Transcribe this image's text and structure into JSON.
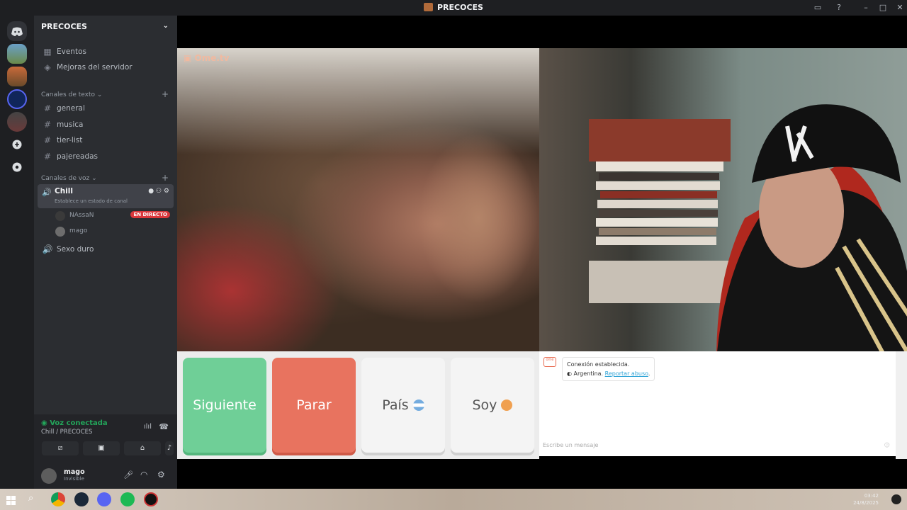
{
  "window": {
    "title": "PRECOCES"
  },
  "server": {
    "name": "PRECOCES"
  },
  "nav": [
    {
      "label": "Eventos",
      "icon": "calendar-icon"
    },
    {
      "label": "Mejoras del servidor",
      "icon": "boost-icon"
    }
  ],
  "text_category": {
    "label": "Canales de texto"
  },
  "text_channels": [
    {
      "label": "general"
    },
    {
      "label": "musica"
    },
    {
      "label": "tier-list"
    },
    {
      "label": "pajereadas"
    }
  ],
  "voice_category": {
    "label": "Canales de voz"
  },
  "voice_channels": {
    "active": {
      "label": "Chill",
      "status": "Establece un estado de canal"
    },
    "members": [
      {
        "name": "NAssaN",
        "badge": "EN DIRECTO"
      },
      {
        "name": "mago"
      }
    ],
    "other": {
      "label": "Sexo duro"
    }
  },
  "voice_panel": {
    "status": "Voz conectada",
    "location": "Chill / PRECOCES"
  },
  "user_panel": {
    "name": "mago",
    "status": "Invisible"
  },
  "ometv": {
    "logo": "Ome.tv",
    "buttons": {
      "next": "Siguiente",
      "stop": "Parar",
      "country": "País",
      "gender": "Soy"
    },
    "chat": {
      "connected": "Conexión establecida.",
      "country": "Argentina.",
      "report": "Reportar abuso",
      "placeholder": "Escribe un mensaje"
    }
  },
  "colors": {
    "next": "#6fcf97",
    "stop": "#e8735f",
    "discord_bg": "#2b2d31",
    "live": "#da373c"
  },
  "taskbar": {
    "time": "03:42",
    "date": "24/8/2025"
  }
}
